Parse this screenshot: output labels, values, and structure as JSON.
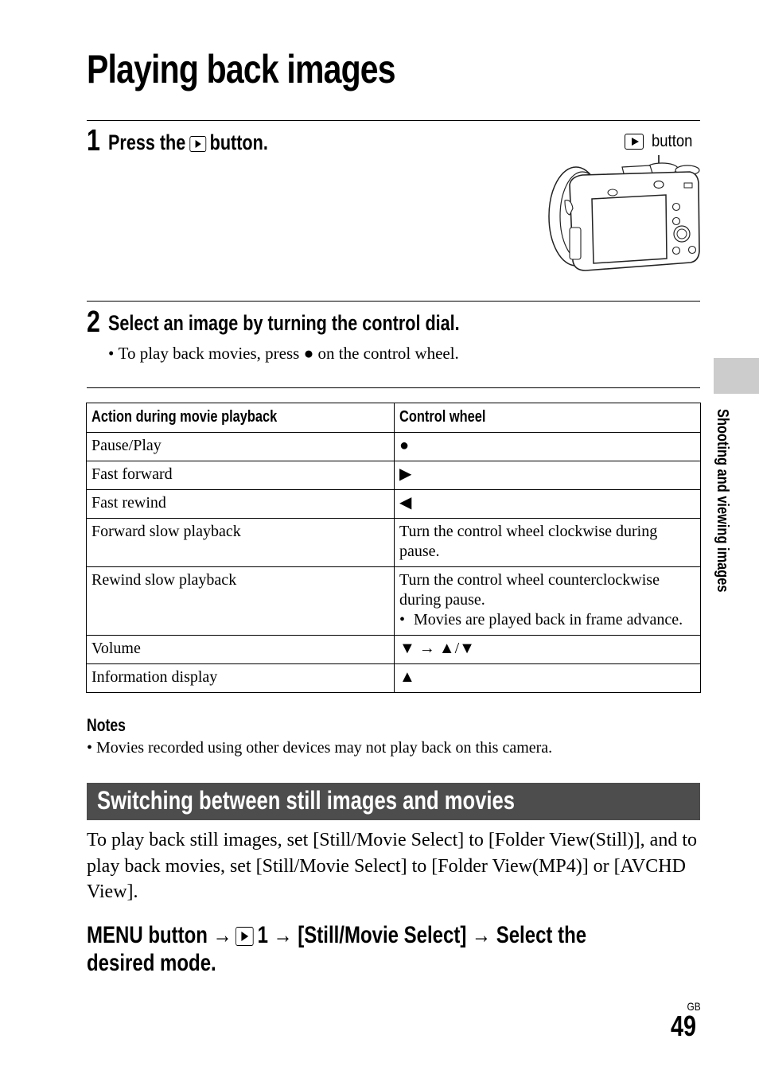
{
  "page": {
    "title": "Playing back images",
    "side_tab_label": "Shooting and viewing images",
    "region_label": "GB",
    "page_number": "49"
  },
  "step1": {
    "number": "1",
    "text_before": "Press the",
    "icon": "playback-button-icon",
    "text_after": "button.",
    "illustration": {
      "callout_label": "button",
      "callout_icon": "playback-button-icon",
      "description": "camera-rear-view"
    }
  },
  "step2": {
    "number": "2",
    "text": "Select an image by turning the control dial.",
    "bullet": {
      "before": "To play back movies, press",
      "symbol": "●",
      "after": "on the control wheel."
    }
  },
  "table": {
    "headers": [
      "Action during movie playback",
      "Control wheel"
    ],
    "rows": [
      {
        "action": "Pause/Play",
        "control": "●"
      },
      {
        "action": "Fast forward",
        "control": "▶"
      },
      {
        "action": "Fast rewind",
        "control": "◀"
      },
      {
        "action": "Forward slow playback",
        "control": "Turn the control wheel clockwise during pause."
      },
      {
        "action": "Rewind slow playback",
        "control": "Turn the control wheel counterclockwise during pause.",
        "control_bullet": "Movies are played back in frame advance."
      },
      {
        "action": "Volume",
        "control": "▼ → ▲/▼"
      },
      {
        "action": "Information display",
        "control": "▲"
      }
    ]
  },
  "notes": {
    "label": "Notes",
    "items": [
      "Movies recorded using other devices may not play back on this camera."
    ]
  },
  "section": {
    "title": "Switching between still images and movies",
    "paragraph": "To play back still images, set [Still/Movie Select] to [Folder View(Still)], and to play back movies, set [Still/Movie Select] to [Folder View(MP4)] or [AVCHD View].",
    "menu_path": {
      "part1": "MENU button →",
      "icon": "playback-menu-icon",
      "part2": "1 → [Still/Movie Select] → Select the desired mode."
    }
  },
  "colors": {
    "section_bar": "#4d4d4d",
    "side_tab": "#cccccc",
    "text": "#000000"
  }
}
